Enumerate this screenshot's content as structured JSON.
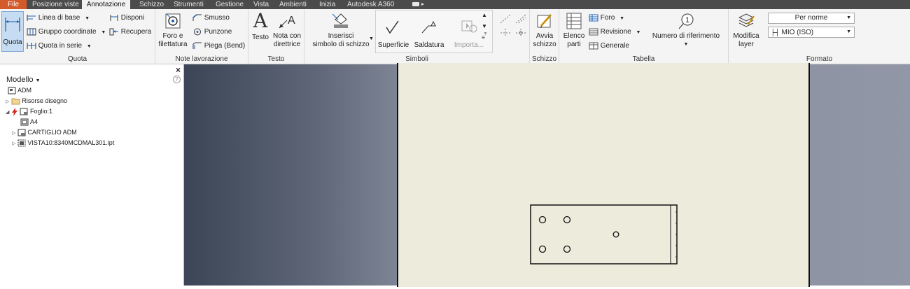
{
  "menu_tabs": [
    "File",
    "Posizione viste",
    "Annotazione",
    "Schizzo",
    "Strumenti",
    "Gestione",
    "Vista",
    "Ambienti",
    "Inizia",
    "Autodesk A360"
  ],
  "active_tab": "Annotazione",
  "ribbon": {
    "quota": {
      "big_label": "Quota",
      "linea_di_base": "Linea di base",
      "gruppo_coordinate": "Gruppo coordinate",
      "quota_in_serie": "Quota in serie",
      "disponi": "Disponi",
      "recupera": "Recupera",
      "title": "Quota"
    },
    "note_lavorazione": {
      "foro_line1": "Foro e",
      "foro_line2": "filettatura",
      "smusso": "Smusso",
      "punzone": "Punzone",
      "piega": "Piega (Bend)",
      "title": "Note lavorazione"
    },
    "testo": {
      "testo": "Testo",
      "nota_line1": "Nota con",
      "nota_line2": "direttrice",
      "title": "Testo"
    },
    "simboli": {
      "inserisci_line1": "Inserisci",
      "inserisci_line2": "simbolo di schizzo",
      "superficie": "Superficie",
      "saldatura": "Saldatura",
      "importa": "Importa...",
      "title": "Simboli"
    },
    "schizzo": {
      "avvia_line1": "Avvia",
      "avvia_line2": "schizzo",
      "title": "Schizzo"
    },
    "tabella": {
      "elenco_line1": "Elenco",
      "elenco_line2": "parti",
      "foro": "Foro",
      "revisione": "Revisione",
      "generale": "Generale",
      "numero_riferimento": "Numero di riferimento",
      "title": "Tabella"
    },
    "formato": {
      "modifica_line1": "Modifica",
      "modifica_line2": "layer",
      "style_select": "Per norme",
      "layer_select": "MIO (ISO)",
      "title": "Formato"
    }
  },
  "browser": {
    "title": "Modello",
    "items": [
      {
        "label": "ADM"
      },
      {
        "label": "Risorse disegno"
      },
      {
        "label": "Foglio:1"
      },
      {
        "label": "A4"
      },
      {
        "label": "CARTIGLIO ADM"
      },
      {
        "label": "VISTA10:8340MCDMAL301.ipt"
      }
    ],
    "close_symbol": "×",
    "help_symbol": "?"
  },
  "colors": {
    "menubar": "#4b4b4b",
    "file_tab": "#d35a2a",
    "ribbon_bg": "#f4f4f4",
    "sheet_bg": "#edebdc",
    "active_button": "#c6dcf2"
  }
}
